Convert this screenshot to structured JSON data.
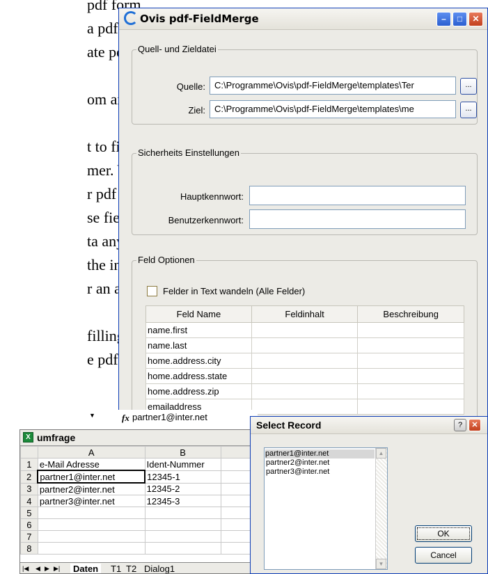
{
  "background_text": {
    "lines": [
      "pdf form",
      "a pdf",
      "ate person-",
      "om an Ex-",
      "t to fill in",
      "mer. You",
      "r pdf form",
      "se fields",
      "ta any-",
      "the indi-",
      "r an auto-",
      "filling out",
      "e pdf form"
    ]
  },
  "main_window": {
    "title": "Ovis pdf-FieldMerge",
    "source_group": {
      "legend": "Quell- und Zieldatei",
      "source_label": "Quelle:",
      "source_value": "C:\\Programme\\Ovis\\pdf-FieldMerge\\templates\\Ter",
      "target_label": "Ziel:",
      "target_value": "C:\\Programme\\Ovis\\pdf-FieldMerge\\templates\\me",
      "browse_label": "..."
    },
    "security_group": {
      "legend": "Sicherheits Einstellungen",
      "master_pw_label": "Hauptkennwort:",
      "user_pw_label": "Benutzerkennwort:"
    },
    "field_group": {
      "legend": "Feld Optionen",
      "checkbox_label": "Felder in Text wandeln (Alle Felder)",
      "columns": [
        "Feld Name",
        "Feldinhalt",
        "Beschreibung"
      ],
      "rows": [
        "name.first",
        "name.last",
        "home.address.city",
        "home.address.state",
        "home.address.zip",
        "emailaddress"
      ]
    }
  },
  "formula_bar": {
    "fx": "fx",
    "value": "partner1@inter.net"
  },
  "excel": {
    "title": "umfrage",
    "col_headers": [
      "A",
      "B"
    ],
    "rows": [
      {
        "num": "1",
        "a": "e-Mail Adresse",
        "b": "Ident-Nummer"
      },
      {
        "num": "2",
        "a": "partner1@inter.net",
        "b": "12345-1"
      },
      {
        "num": "3",
        "a": "partner2@inter.net",
        "b": "12345-2"
      },
      {
        "num": "4",
        "a": "partner3@inter.net",
        "b": "12345-3"
      },
      {
        "num": "5",
        "a": "",
        "b": ""
      },
      {
        "num": "6",
        "a": "",
        "b": ""
      },
      {
        "num": "7",
        "a": "",
        "b": ""
      },
      {
        "num": "8",
        "a": "",
        "b": ""
      }
    ],
    "sheet_tabs": [
      "Daten",
      "T1",
      "T2",
      "Dialog1"
    ]
  },
  "select_record": {
    "title": "Select Record",
    "items": [
      "partner1@inter.net",
      "partner2@inter.net",
      "partner3@inter.net"
    ],
    "ok_label": "OK",
    "cancel_label": "Cancel"
  },
  "colors": {
    "selection": "#d7d7d7",
    "titlebar_border": "#0b3bb5"
  }
}
